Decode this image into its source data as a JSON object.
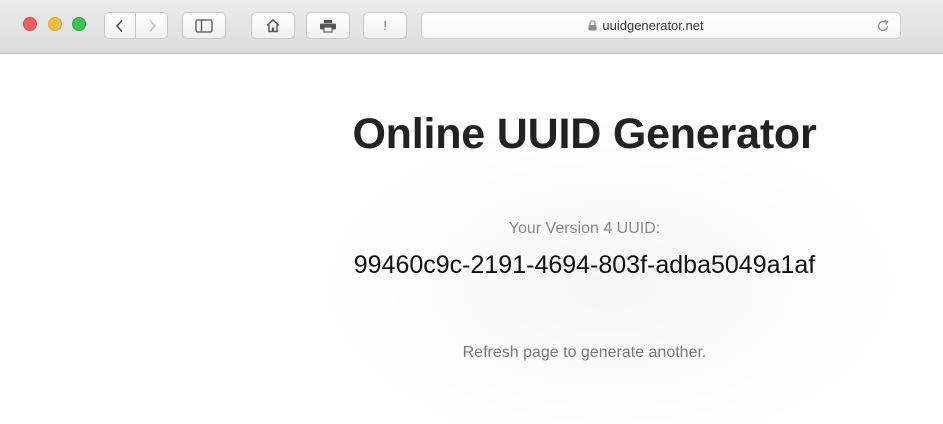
{
  "browser": {
    "url": "uuidgenerator.net",
    "alert_label": "!",
    "icons": {
      "close": "close-icon",
      "minimize": "minimize-icon",
      "zoom": "zoom-icon",
      "back": "chevron-left-icon",
      "forward": "chevron-right-icon",
      "sidebar": "sidebar-icon",
      "home": "home-icon",
      "print": "printer-icon",
      "lock": "lock-icon",
      "reload": "reload-icon"
    },
    "colors": {
      "close": "#fc605c",
      "minimize": "#fdbc40",
      "zoom": "#34c84a"
    }
  },
  "page": {
    "title": "Online UUID Generator",
    "uuid_label": "Your Version 4 UUID:",
    "uuid_value": "99460c9c-2191-4694-803f-adba5049a1af",
    "refresh_note": "Refresh page to generate another."
  }
}
